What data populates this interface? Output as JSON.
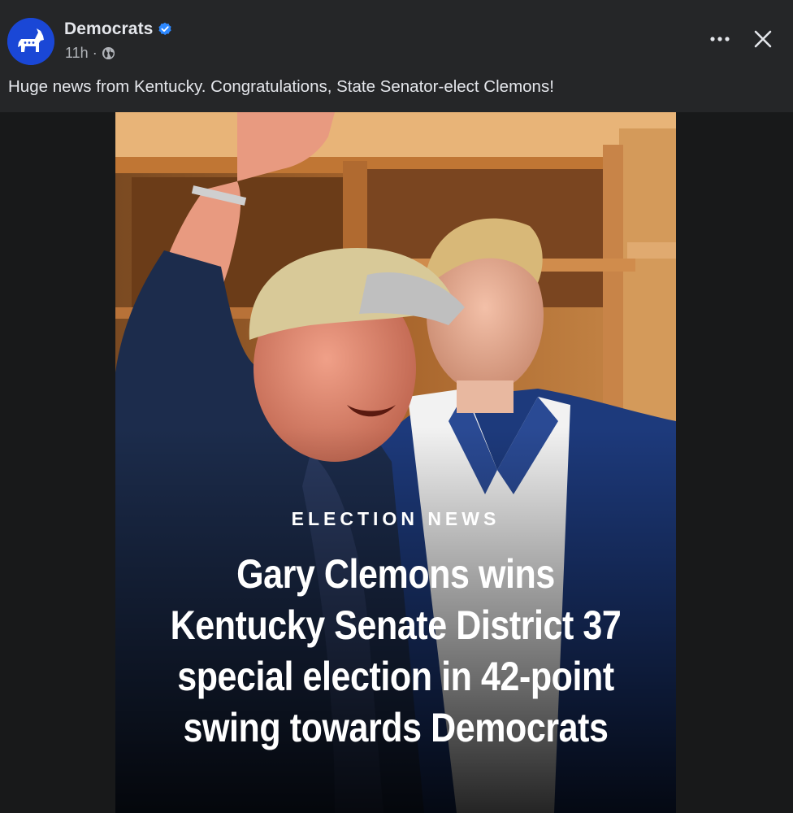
{
  "post": {
    "page_name": "Democrats",
    "timestamp": "11h",
    "separator": "·",
    "caption": "Huge news from Kentucky. Congratulations, State Senator-elect Clemons!",
    "icons": {
      "avatar": "democratic-donkey-logo",
      "verified": "verified-badge-icon",
      "audience": "globe-icon",
      "more": "more-options-icon",
      "close": "close-icon"
    }
  },
  "image": {
    "kicker": "ELECTION NEWS",
    "headline_lines": [
      "Gary Clemons wins",
      "Kentucky Senate District 37",
      "special election in 42-point",
      "swing towards Democrats"
    ]
  },
  "colors": {
    "header_bg": "#252628",
    "page_bg": "#18191a",
    "accent_blue": "#1a47d6",
    "verified_blue": "#2d88ff"
  }
}
